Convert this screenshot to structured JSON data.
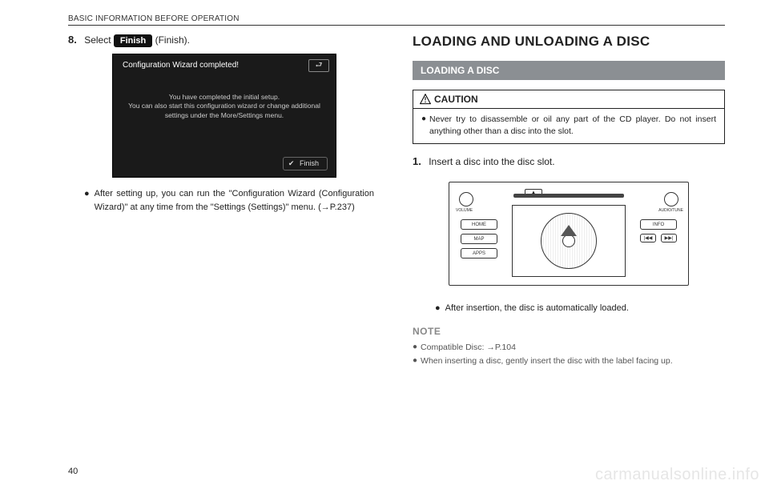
{
  "header": {
    "section": "BASIC INFORMATION BEFORE OPERATION"
  },
  "left": {
    "step_num": "8.",
    "step_prefix": "Select ",
    "step_chip": "Finish",
    "step_suffix": " (Finish).",
    "screenshot": {
      "title": "Configuration Wizard completed!",
      "back_glyph": "⮐",
      "line1": "You have completed the initial setup.",
      "line2": "You can also start this configuration wizard or change additional",
      "line3": "settings under the More/Settings menu.",
      "finish_check": "✔",
      "finish_label": "Finish"
    },
    "bullet": "After setting up, you can run the \"Configuration Wizard (Configuration Wizard)\" at any time from the \"Settings (Settings)\" menu. (→P.237)"
  },
  "right": {
    "h2": "LOADING AND UNLOADING A DISC",
    "subhead": "LOADING A DISC",
    "caution_label": "CAUTION",
    "caution_text": "Never try to disassemble or oil any part of the CD player. Do not insert anything other than a disc into the slot.",
    "step1_num": "1.",
    "step1_text": "Insert a disc into the disc slot.",
    "device": {
      "eject": "▲",
      "home": "HOME",
      "map": "MAP",
      "apps": "APPS",
      "info": "INFO",
      "prev": "|◀◀",
      "next": "▶▶|",
      "vol": "VOLUME",
      "tune": "AUDIO/TUNE"
    },
    "bullet_after": "After insertion, the disc is automatically loaded.",
    "note_head": "NOTE",
    "note1": "Compatible Disc: →P.104",
    "note2": "When inserting a disc, gently insert the disc with the label facing up."
  },
  "page_number": "40",
  "watermark": "carmanualsonline.info"
}
